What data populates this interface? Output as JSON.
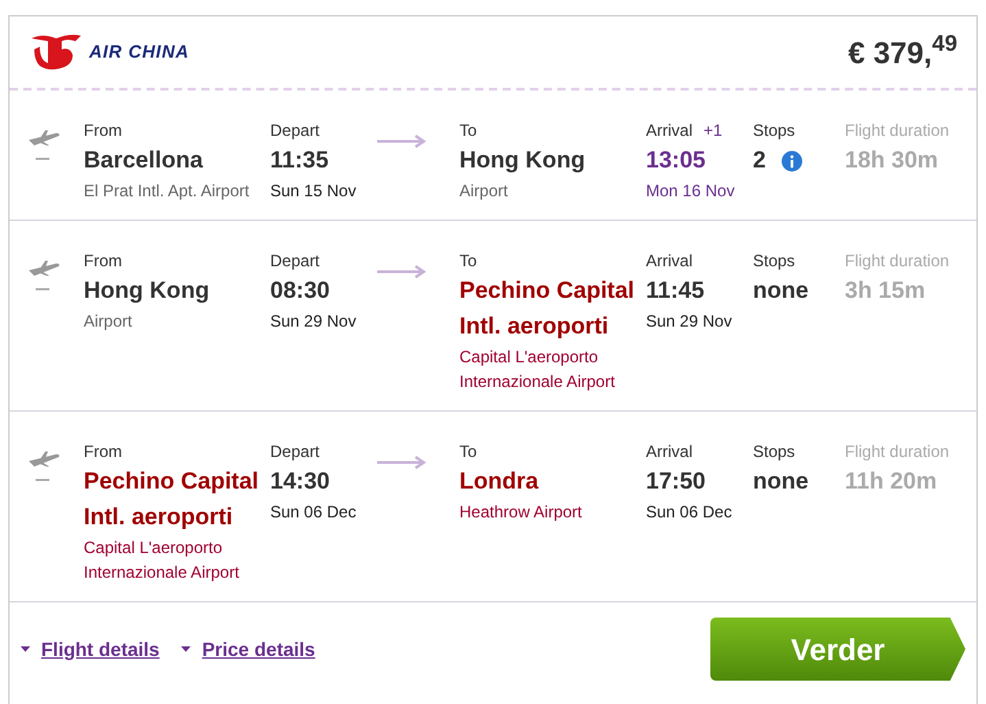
{
  "airline": "AIR CHINA",
  "price": "€ 379,$^{49}$",
  "legs": [
    {
      "from_label": "From",
      "from": "Barcellona",
      "from_highlight": false,
      "from_airport": "El Prat Intl. Apt. Airport",
      "depart_label": "Depart",
      "depart_time": "11:35",
      "depart_date": "Sun 15 Nov",
      "to_label": "To",
      "to": "Hong Kong",
      "to_highlight": false,
      "to_airport": "Airport",
      "arrival_label": "Arrival",
      "day_offset": "+1",
      "next_day": true,
      "arrival_time": "13:05",
      "arrival_date": "Mon 16 Nov",
      "stops_label": "Stops",
      "stops": "2",
      "stops_info": true,
      "duration_label": "Flight duration",
      "duration": "18h 30m"
    },
    {
      "from_label": "From",
      "from": "Hong Kong",
      "from_highlight": false,
      "from_airport": "Airport",
      "depart_label": "Depart",
      "depart_time": "08:30",
      "depart_date": "Sun 29 Nov",
      "to_label": "To",
      "to": "Pechino Capital Intl. aeroporti",
      "to_highlight": true,
      "to_airport": "Capital L'aeroporto Internazionale Airport",
      "arrival_label": "Arrival",
      "next_day": false,
      "arrival_time": "11:45",
      "arrival_date": "Sun 29 Nov",
      "stops_label": "Stops",
      "stops": "none",
      "stops_info": false,
      "duration_label": "Flight duration",
      "duration": "3h 15m"
    },
    {
      "from_label": "From",
      "from": "Pechino Capital Intl. aeroporti",
      "from_highlight": true,
      "from_airport": "Capital L'aeroporto Internazionale Airport",
      "depart_label": "Depart",
      "depart_time": "14:30",
      "depart_date": "Sun 06 Dec",
      "to_label": "To",
      "to": "Londra",
      "to_highlight": true,
      "to_airport": "Heathrow Airport",
      "arrival_label": "Arrival",
      "next_day": false,
      "arrival_time": "17:50",
      "arrival_date": "Sun 06 Dec",
      "stops_label": "Stops",
      "stops": "none",
      "stops_info": false,
      "duration_label": "Flight duration",
      "duration": "11h 20m"
    }
  ],
  "links": [
    {
      "label": "Flight details",
      "expanded": false
    },
    {
      "label": "Price details",
      "expanded": false
    }
  ],
  "button": "Verder"
}
